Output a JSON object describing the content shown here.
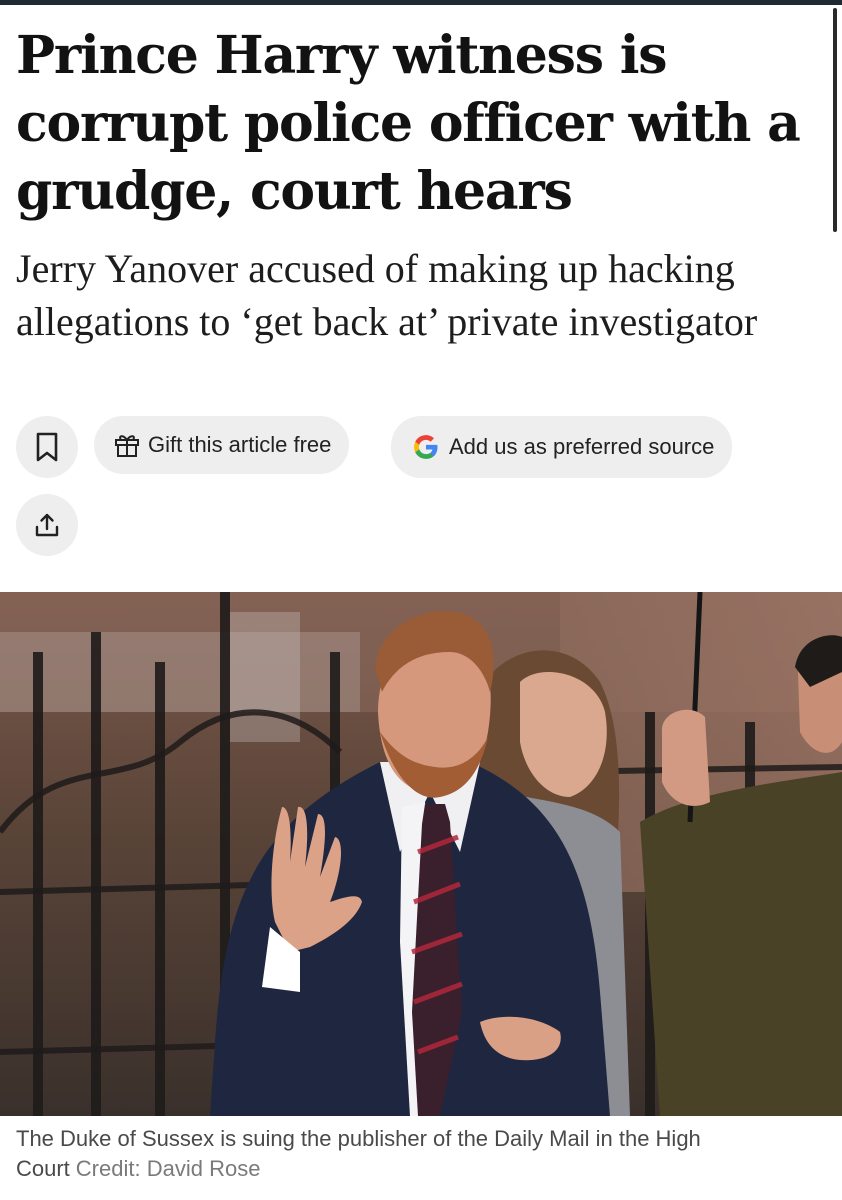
{
  "article": {
    "headline": "Prince Harry witness is corrupt police officer with a grudge, court hears",
    "standfirst": "Jerry Yanover accused of making up hacking allegations to ‘get back at’ private investigator"
  },
  "actions": {
    "bookmark_icon": "bookmark-icon",
    "gift_icon": "gift-icon",
    "gift_label": "Gift this article free",
    "google_icon": "google-g-icon",
    "preferred_source_label": "Add us as preferred source",
    "share_icon": "share-icon"
  },
  "photo": {
    "subject": "photo of a man in a navy suit and striped tie waving outside a courthouse, with a woman and another man holding an umbrella behind him"
  },
  "caption": {
    "text": "The Duke of Sussex is suing the publisher of the Daily Mail in the High Court",
    "credit": "Credit: David Rose"
  },
  "colors": {
    "button_bg": "#eeeeee",
    "google_blue": "#4285F4",
    "google_red": "#EA4335",
    "google_yellow": "#FBBC05",
    "google_green": "#34A853"
  }
}
